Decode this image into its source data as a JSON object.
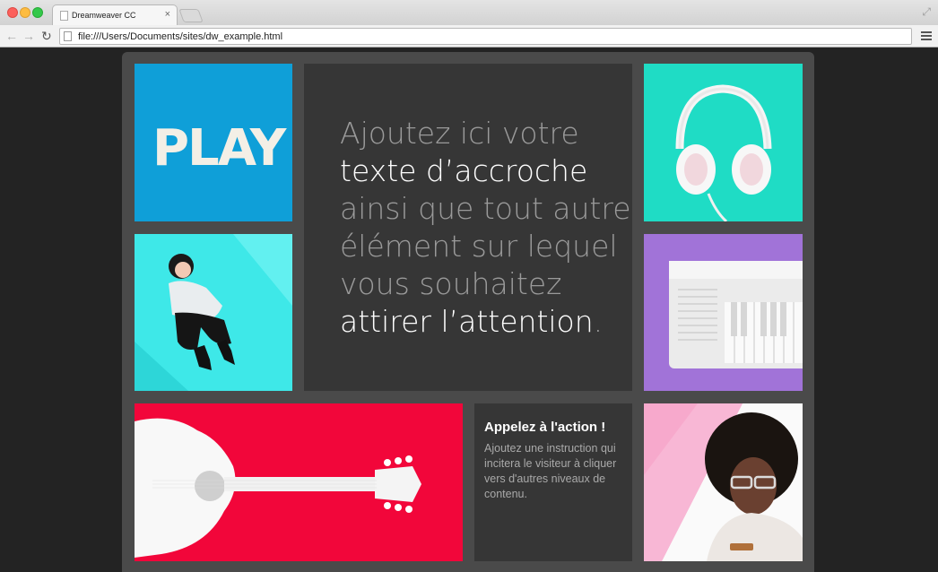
{
  "browser": {
    "tab_title": "Dreamweaver CC",
    "tab_close": "×",
    "url": "file:///Users/Documents/sites/dw_example.html",
    "icons": [
      "back-arrow-icon",
      "forward-arrow-icon",
      "reload-icon",
      "menu-icon",
      "page-icon",
      "fullscreen-icon"
    ]
  },
  "tiles": {
    "play_text": "PLAY",
    "hero": {
      "line1": "Ajoutez ici votre",
      "line2": "texte d’accroche",
      "line3": "ainsi que tout autre",
      "line4": "élément sur lequel",
      "line5": "vous souhaitez",
      "line6": "attirer l’attention",
      "line6_end": "."
    },
    "cta": {
      "title": "Appelez à l'action !",
      "body": "Ajoutez une instruction qui incitera le visiteur à cliquer vers d'autres niveaux de contenu."
    }
  },
  "colors": {
    "play_bg": "#0f9fd8",
    "headphones_bg": "#1fdcc5",
    "girl_bg": "#3ee8e8",
    "piano_bg": "#a173d8",
    "guitar_bg": "#f2063a",
    "dark_tile": "#363636",
    "page_bg": "#4a4a4a"
  }
}
